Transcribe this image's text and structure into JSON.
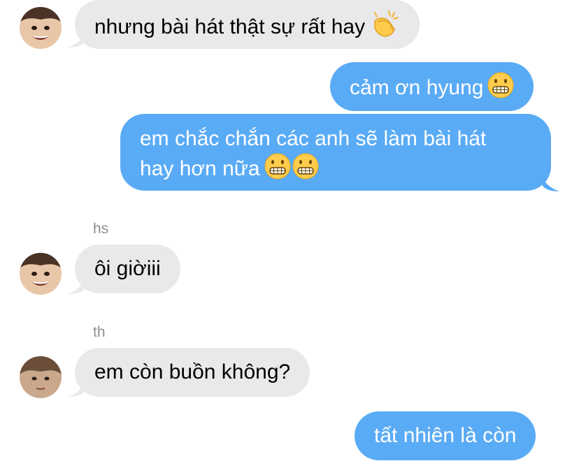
{
  "colors": {
    "incoming_bubble": "#e9e9eb",
    "outgoing_bubble": "#5aabf5",
    "sender_label": "#8e8e93"
  },
  "messages": [
    {
      "direction": "incoming",
      "text": "nhưng bài hát thật sự rất hay",
      "emoji": [
        "clapping-hands-icon"
      ]
    },
    {
      "direction": "outgoing",
      "text": "cảm ơn hyung",
      "emoji": [
        "grimacing-face-icon"
      ]
    },
    {
      "direction": "outgoing",
      "text_line1": "em chắc chắn các anh sẽ làm bài hát",
      "text_line2": "hay hơn nữa",
      "emoji": [
        "grimacing-face-icon",
        "grimacing-face-icon"
      ]
    },
    {
      "direction": "incoming",
      "sender": "hs",
      "text": "ôi giờiii"
    },
    {
      "direction": "incoming",
      "sender": "th",
      "text": "em còn buồn không?"
    },
    {
      "direction": "outgoing",
      "text": "tất nhiên là còn"
    }
  ]
}
